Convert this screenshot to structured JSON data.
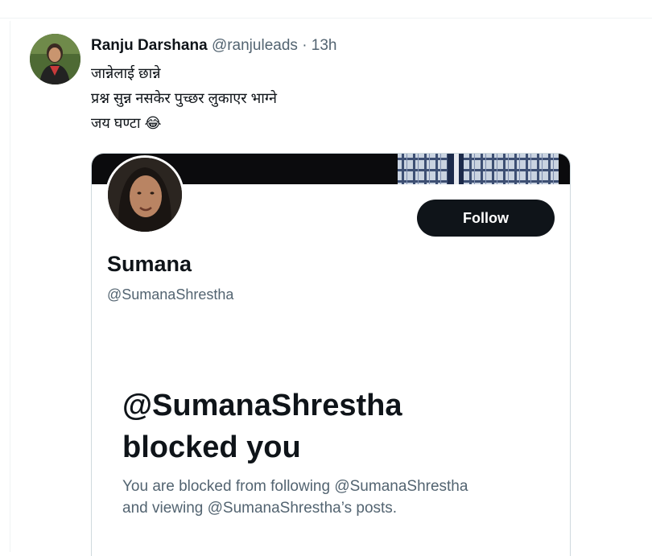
{
  "tweet": {
    "author_name": "Ranju Darshana",
    "author_handle": "@ranjuleads",
    "separator": "·",
    "time": "13h",
    "lines": [
      "जान्नेलाई छान्ने",
      "प्रश्न सुन्न नसकेर पुच्छर लुकाएर भाग्ने",
      "जय घण्टा 😂"
    ]
  },
  "card": {
    "profile_name": "Sumana",
    "profile_handle": "@SumanaShrestha",
    "follow_label": "Follow",
    "blocked_title_line1": "@SumanaShrestha",
    "blocked_title_line2": "blocked you",
    "blocked_desc_line1": "You are blocked from following @SumanaShrestha",
    "blocked_desc_line2": "and viewing @SumanaShrestha’s posts."
  },
  "colors": {
    "text_primary": "#0f1419",
    "text_secondary": "#536471",
    "follow_button_bg": "#0f1419",
    "border": "#cfd9de"
  }
}
